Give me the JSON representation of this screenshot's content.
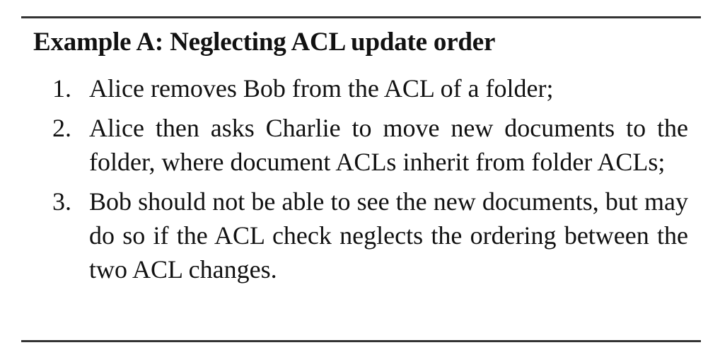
{
  "example": {
    "title": "Example A: Neglecting ACL update order",
    "steps": [
      {
        "number": "1.",
        "text": "Alice removes Bob from the ACL of a folder;"
      },
      {
        "number": "2.",
        "text": "Alice then asks Charlie to move new documents to the folder, where document ACLs inherit from folder ACLs;"
      },
      {
        "number": "3.",
        "text": "Bob should not be able to see the new documents, but may do so if the ACL check neglects the ordering between the two ACL changes."
      }
    ]
  }
}
